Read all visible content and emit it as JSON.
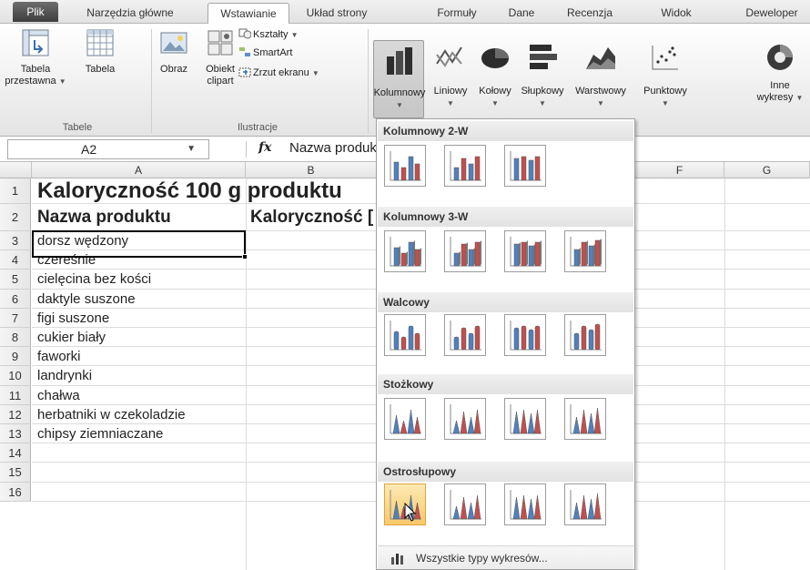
{
  "tabs": [
    {
      "label": "Plik"
    },
    {
      "label": "Narzędzia główne"
    },
    {
      "label": "Wstawianie"
    },
    {
      "label": "Układ strony"
    },
    {
      "label": "Formuły"
    },
    {
      "label": "Dane"
    },
    {
      "label": "Recenzja"
    },
    {
      "label": "Widok"
    },
    {
      "label": "Deweloper"
    }
  ],
  "ribbon": {
    "pivot_l1": "Tabela",
    "pivot_l2": "przestawna",
    "table": "Tabela",
    "picture": "Obraz",
    "clipart_l1": "Obiekt",
    "clipart_l2": "clipart",
    "shapes": "Kształty",
    "smartart": "SmartArt",
    "screenshot": "Zrzut ekranu",
    "chart_column": "Kolumnowy",
    "chart_line": "Liniowy",
    "chart_pie": "Kołowy",
    "chart_bar": "Słupkowy",
    "chart_area": "Warstwowy",
    "chart_scatter": "Punktowy",
    "chart_other_l1": "Inne",
    "chart_other_l2": "wykresy",
    "group_tables": "Tabele",
    "group_illustrations": "Ilustracje"
  },
  "formula_bar": {
    "name_box": "A2",
    "fx": "fx",
    "content": "Nazwa produktu"
  },
  "columns": [
    "A",
    "B",
    "F",
    "G"
  ],
  "rows": [
    {
      "num": "1",
      "a": "Kaloryczność 100 g produktu"
    },
    {
      "num": "2",
      "a": "Nazwa produktu",
      "b": "Kaloryczność ["
    },
    {
      "num": "3",
      "a": "dorsz wędzony"
    },
    {
      "num": "4",
      "a": "czereśnie"
    },
    {
      "num": "5",
      "a": "cielęcina bez kości"
    },
    {
      "num": "6",
      "a": "daktyle suszone"
    },
    {
      "num": "7",
      "a": "figi suszone"
    },
    {
      "num": "8",
      "a": "cukier biały"
    },
    {
      "num": "9",
      "a": "faworki"
    },
    {
      "num": "10",
      "a": "landrynki"
    },
    {
      "num": "11",
      "a": "chałwa"
    },
    {
      "num": "12",
      "a": "herbatniki w czekoladzie"
    },
    {
      "num": "13",
      "a": "chipsy ziemniaczane"
    },
    {
      "num": "14",
      "a": ""
    },
    {
      "num": "15",
      "a": ""
    },
    {
      "num": "16",
      "a": ""
    }
  ],
  "dropdown": {
    "sections": [
      "Kolumnowy 2-W",
      "Kolumnowy 3-W",
      "Walcowy",
      "Stożkowy",
      "Ostrosłupowy"
    ],
    "all_types": "Wszystkie typy wykresów..."
  },
  "colors": {
    "file_tab": "#4a4a4a",
    "hover_tile": "#f8c96a",
    "chart_blue": "#4f81bd",
    "chart_red": "#c0504d"
  }
}
